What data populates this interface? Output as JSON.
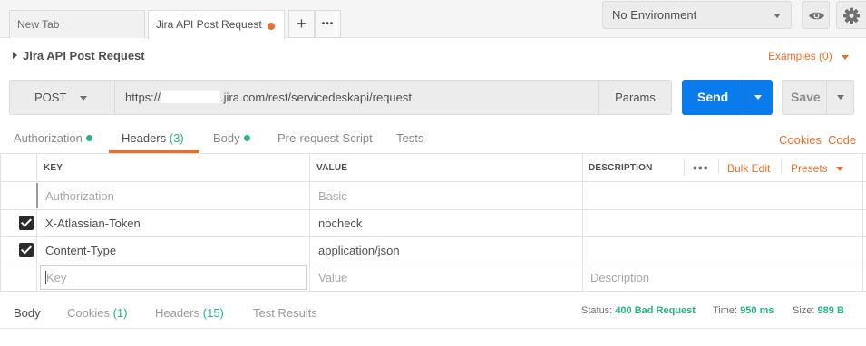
{
  "tabs": [
    {
      "label": "New Tab"
    },
    {
      "label": "Jira API Post Request"
    }
  ],
  "new_tab_symbol": "+",
  "more_symbol": "•••",
  "environment": {
    "selected": "No Environment"
  },
  "request": {
    "title": "Jira API Post Request",
    "examples_label": "Examples (0)",
    "method": "POST",
    "url_prefix": "https://",
    "url_suffix": ".jira.com/rest/servicedeskapi/request",
    "params_label": "Params",
    "send_label": "Send",
    "save_label": "Save"
  },
  "request_tabs": {
    "authorization": "Authorization",
    "headers": "Headers",
    "headers_count": "(3)",
    "body": "Body",
    "pre_request": "Pre-request Script",
    "tests": "Tests",
    "cookies": "Cookies",
    "code": "Code"
  },
  "headers_table": {
    "col_key": "KEY",
    "col_value": "VALUE",
    "col_description": "DESCRIPTION",
    "bulk_edit": "Bulk Edit",
    "presets": "Presets",
    "rows": [
      {
        "key": "Authorization",
        "value": "Basic",
        "description": "",
        "checked": false
      },
      {
        "key": "X-Atlassian-Token",
        "value": "nocheck",
        "description": "",
        "checked": true
      },
      {
        "key": "Content-Type",
        "value": "application/json",
        "description": "",
        "checked": true
      }
    ],
    "placeholder": {
      "key": "Key",
      "value": "Value",
      "description": "Description"
    }
  },
  "response": {
    "body": "Body",
    "cookies": "Cookies",
    "cookies_count": "(1)",
    "headers": "Headers",
    "headers_count": "(15)",
    "test_results": "Test Results",
    "status_label": "Status:",
    "status_value": "400 Bad Request",
    "time_label": "Time:",
    "time_value": "950 ms",
    "size_label": "Size:",
    "size_value": "989 B"
  },
  "colors": {
    "accent": "#e8702a",
    "send": "#097bed",
    "success": "#26b47f"
  }
}
